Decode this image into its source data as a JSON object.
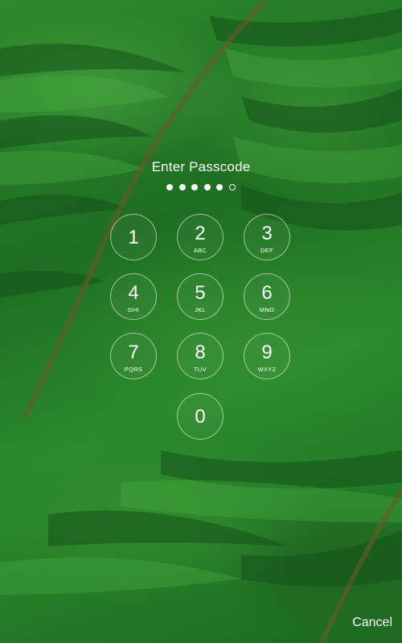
{
  "lock_screen": {
    "title": "Enter Passcode",
    "passcode": {
      "entered": 5,
      "length": 6
    },
    "cancel_label": "Cancel",
    "wallpaper_colors": {
      "light": "#2e8a2c",
      "dark": "#15501a",
      "stem": "#6b5a2a"
    }
  },
  "keypad": {
    "keys": [
      {
        "digit": "1",
        "letters": ""
      },
      {
        "digit": "2",
        "letters": "ABC"
      },
      {
        "digit": "3",
        "letters": "DEF"
      },
      {
        "digit": "4",
        "letters": "GHI"
      },
      {
        "digit": "5",
        "letters": "JKL"
      },
      {
        "digit": "6",
        "letters": "MNO"
      },
      {
        "digit": "7",
        "letters": "PQRS"
      },
      {
        "digit": "8",
        "letters": "TUV"
      },
      {
        "digit": "9",
        "letters": "WXYZ"
      },
      {
        "digit": "0",
        "letters": ""
      }
    ]
  }
}
